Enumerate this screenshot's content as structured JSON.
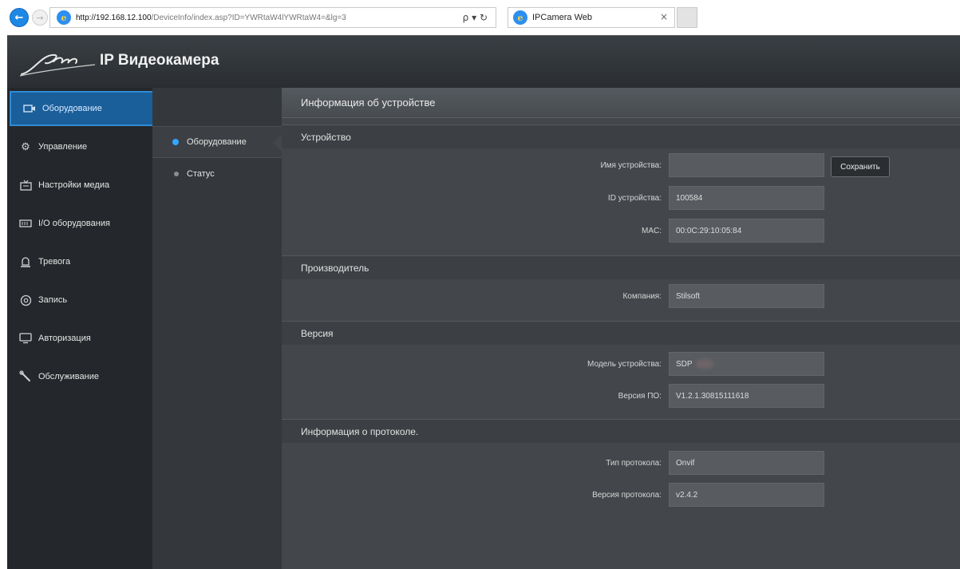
{
  "browser": {
    "url_host": "http://192.168.12.100",
    "url_path": "/DeviceInfo/index.asp?ID=YWRtaW4lYWRtaW4=&lg=3",
    "search_tools": "ρ ▾ ↻",
    "tab_title": "IPCamera Web",
    "tab_close": "×"
  },
  "header": {
    "title": "IP Видеокамера"
  },
  "sidebar": {
    "items": [
      {
        "label": "Оборудование",
        "icon": "camera-icon",
        "active": true
      },
      {
        "label": "Управление",
        "icon": "gear-icon",
        "active": false
      },
      {
        "label": "Настройки медиа",
        "icon": "media-icon",
        "active": false
      },
      {
        "label": "I/O оборудования",
        "icon": "io-icon",
        "active": false
      },
      {
        "label": "Тревога",
        "icon": "alarm-icon",
        "active": false
      },
      {
        "label": "Запись",
        "icon": "record-icon",
        "active": false
      },
      {
        "label": "Авторизация",
        "icon": "monitor-icon",
        "active": false
      },
      {
        "label": "Обслуживание",
        "icon": "wrench-icon",
        "active": false
      }
    ]
  },
  "subnav": {
    "items": [
      {
        "label": "Оборудование",
        "active": true
      },
      {
        "label": "Статус",
        "active": false
      }
    ]
  },
  "content": {
    "title": "Информация об устройстве",
    "sections": {
      "device": {
        "title": "Устройство",
        "name_label": "Имя устройства:",
        "name_value": "",
        "save_label": "Сохранить",
        "id_label": "ID устройства:",
        "id_value": "100584",
        "mac_label": "MAC:",
        "mac_value": "00:0C:29:10:05:84"
      },
      "manufacturer": {
        "title": "Производитель",
        "company_label": "Компания:",
        "company_value": "Stilsoft"
      },
      "version": {
        "title": "Версия",
        "model_label": "Модель устройства:",
        "model_value": "SDP",
        "fw_label": "Версия ПО:",
        "fw_value": "V1.2.1.30815111618"
      },
      "protocol": {
        "title": "Информация о протоколе.",
        "type_label": "Тип протокола:",
        "type_value": "Onvif",
        "ver_label": "Версия протокола:",
        "ver_value": "v2.4.2"
      }
    }
  }
}
